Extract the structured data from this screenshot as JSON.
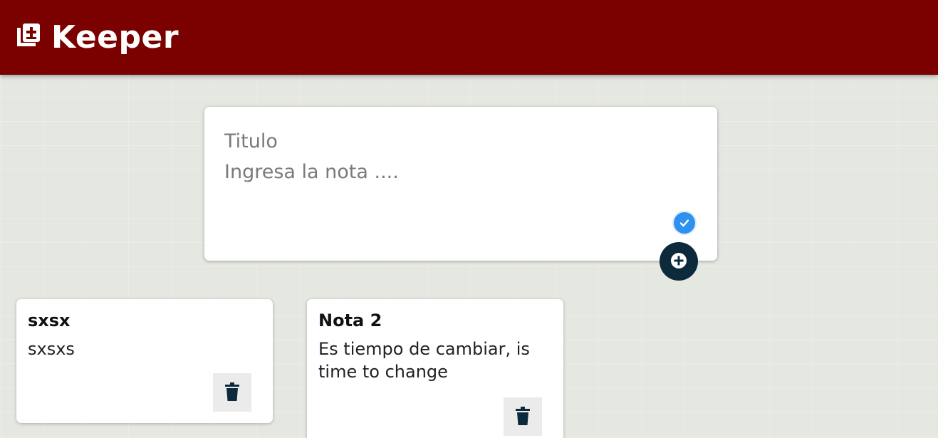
{
  "header": {
    "title": "Keeper",
    "logo_icon": "note-add-icon",
    "background_color": "#7b0101"
  },
  "create_note": {
    "title_placeholder": "Titulo",
    "content_placeholder": "Ingresa la nota ....",
    "check_icon": "check-circle-icon",
    "add_icon": "add-circle-icon"
  },
  "notes": [
    {
      "title": "sxsx",
      "content": "sxsxs",
      "delete_icon": "trash-icon"
    },
    {
      "title": "Nota 2",
      "content": "Es tiempo de cambiar, is time to change",
      "delete_icon": "trash-icon"
    }
  ],
  "colors": {
    "accent_dark": "#0c2a3b",
    "check_blue": "#2e90ef"
  }
}
